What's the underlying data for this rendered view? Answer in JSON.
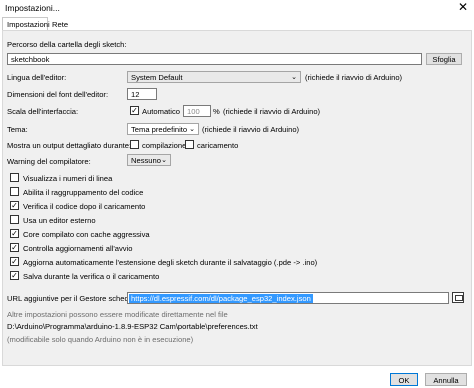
{
  "window": {
    "title": "Impostazioni...",
    "close_glyph": "✕"
  },
  "tabs": [
    {
      "label": "Impostazioni"
    },
    {
      "label": "Rete"
    }
  ],
  "sketchbook": {
    "label": "Percorso della cartella degli sketch:",
    "value": "sketchbook",
    "browse_label": "Sfoglia"
  },
  "language": {
    "label": "Lingua dell'editor:",
    "value": "System Default",
    "note": "(richiede il riavvio di Arduino)"
  },
  "font_size": {
    "label": "Dimensioni del font dell'editor:",
    "value": "12"
  },
  "scale": {
    "label": "Scala dell'interfaccia:",
    "auto_label": "Automatico",
    "auto_checked": true,
    "value": "100",
    "percent": "%",
    "note": "(richiede il riavvio di Arduino)"
  },
  "theme": {
    "label": "Tema:",
    "value": "Tema predefinito",
    "note": "(richiede il riavvio di Arduino)"
  },
  "verbose": {
    "label": "Mostra un output dettagliato durante:",
    "compile_label": "compilazione",
    "compile_checked": false,
    "upload_label": "caricamento",
    "upload_checked": false
  },
  "warnings": {
    "label": "Warning del compilatore:",
    "value": "Nessuno"
  },
  "options": [
    {
      "label": "Visualizza i numeri di linea",
      "checked": false
    },
    {
      "label": "Abilita il raggruppamento del codice",
      "checked": false
    },
    {
      "label": "Verifica il codice dopo il caricamento",
      "checked": true
    },
    {
      "label": "Usa un editor esterno",
      "checked": false
    },
    {
      "label": "Core compilato con cache aggressiva",
      "checked": true
    },
    {
      "label": "Controlla aggiornamenti all'avvio",
      "checked": true
    },
    {
      "label": "Aggiorna automaticamente l'estensione degli sketch durante il salvataggio (.pde -> .ino)",
      "checked": true
    },
    {
      "label": "Salva durante la verifica o il caricamento",
      "checked": true
    }
  ],
  "boards_url": {
    "label": "URL aggiuntive per il Gestore schede:",
    "value": "https://dl.espressif.com/dl/package_esp32_index.json"
  },
  "info": {
    "line1": "Altre impostazioni possono essere modificate direttamente nel file",
    "path": "D:\\Arduino\\Programma\\arduino-1.8.9-ESP32 Cam\\portable\\preferences.txt",
    "line3": "(modificabile solo quando Arduino non è in esecuzione)"
  },
  "buttons": {
    "ok": "OK",
    "cancel": "Annulla"
  },
  "check_glyph": "✓",
  "dropdown_glyph": "⌄"
}
